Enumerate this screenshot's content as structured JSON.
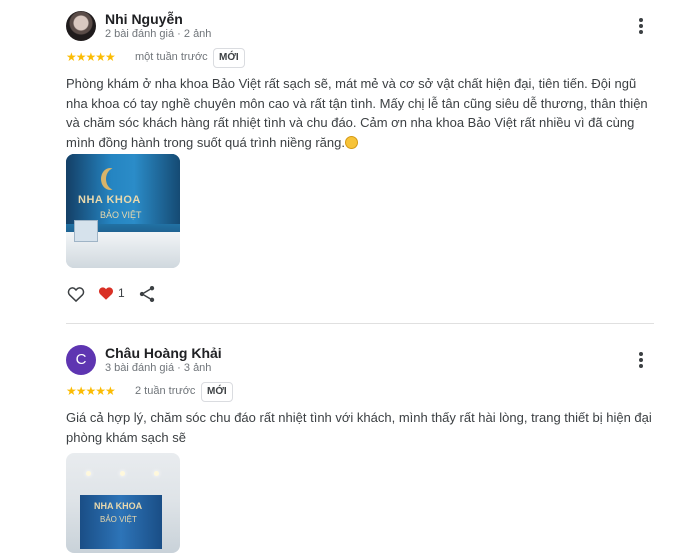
{
  "reviews": [
    {
      "author": "Nhi Nguyễn",
      "meta": "2 bài đánh giá · 2 ảnh",
      "stars": "★★★★★",
      "rating": 5,
      "time": "một tuần trước",
      "badge": "MỚI",
      "text": "Phòng khám ở nha khoa Bảo Việt rất sạch sẽ, mát mẻ và cơ sở vật chất hiện đại, tiên tiến. Đội ngũ nha khoa có tay nghề chuyên môn cao và rất tận tình. Mấy chị lễ tân cũng siêu dễ thương, thân thiện và chăm sóc khách hàng rất nhiệt tình và chu đáo. Cảm ơn nha khoa Bảo Việt rất nhiều vì đã cùng mình đồng hành trong suốt quá trình niềng răng.",
      "emoji": "smiling-face-emoji",
      "photo_sign": "NHA KHOA",
      "photo_sign2": "BẢO VIỆT",
      "like_count": "1"
    },
    {
      "author": "Châu Hoàng Khải",
      "avatar_letter": "C",
      "meta": "3 bài đánh giá · 3 ảnh",
      "stars": "★★★★★",
      "rating": 5,
      "time": "2 tuần trước",
      "badge": "MỚI",
      "text": "Giá cả hợp lý, chăm sóc chu đáo rất nhiệt tình với khách, mình thấy rất hài lòng, trang thiết bị hiện đại phòng khám sạch sẽ",
      "photo_sign": "NHA KHOA",
      "photo_sign2": "BẢO VIỆT"
    }
  ],
  "colors": {
    "star": "#fbbc04",
    "heart": "#d93025",
    "avatar_purple": "#5e35b1"
  },
  "icons": [
    "more-vert-icon",
    "heart-outline-icon",
    "heart-filled-icon",
    "share-icon"
  ]
}
